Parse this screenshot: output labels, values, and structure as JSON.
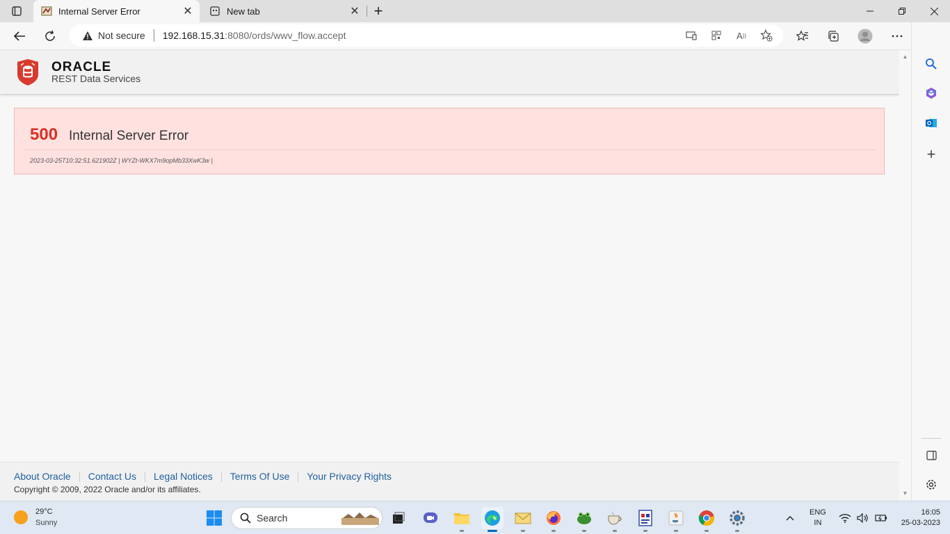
{
  "browser": {
    "tabs": [
      {
        "title": "Internal Server Error",
        "active": true
      },
      {
        "title": "New tab",
        "active": false
      }
    ],
    "security_label": "Not secure",
    "url_host": "192.168.15.31",
    "url_path": ":8080/ords/wwv_flow.accept"
  },
  "header": {
    "brand": "ORACLE",
    "product": "REST Data Services"
  },
  "error": {
    "code": "500",
    "message": "Internal Server Error",
    "meta": "2023-03-25T10:32:51.621902Z | WYZt-WKX7m9opMb33XwK3w |"
  },
  "footer": {
    "links": [
      "About Oracle",
      "Contact Us",
      "Legal Notices",
      "Terms Of Use",
      "Your Privacy Rights"
    ],
    "copyright": "Copyright © 2009, 2022 Oracle and/or its affiliates."
  },
  "taskbar": {
    "weather_temp": "29°C",
    "weather_desc": "Sunny",
    "search_placeholder": "Search",
    "lang": "ENG",
    "region": "IN",
    "time": "16:05",
    "date": "25-03-2023"
  },
  "colors": {
    "error_code": "#d93025",
    "error_bg": "#ffe2e0",
    "link": "#1f5f9e",
    "oracle_red": "#c74634"
  }
}
